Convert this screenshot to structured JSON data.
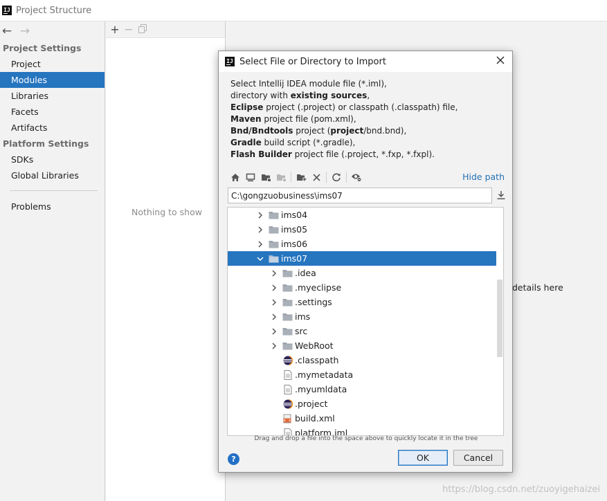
{
  "window": {
    "title": "Project Structure"
  },
  "sidebar": {
    "nav_back": "←",
    "nav_forward": "→",
    "sections": [
      {
        "title": "Project Settings",
        "items": [
          "Project",
          "Modules",
          "Libraries",
          "Facets",
          "Artifacts"
        ]
      },
      {
        "title": "Platform Settings",
        "items": [
          "SDKs",
          "Global Libraries"
        ]
      }
    ],
    "selected_item": "Modules",
    "problems": "Problems"
  },
  "middle": {
    "toolbar": {
      "add": "+",
      "remove": "−",
      "copy": "copy-icon"
    },
    "empty_text": "Nothing to show"
  },
  "right": {
    "partial_text": "details here"
  },
  "dialog": {
    "title": "Select File or Directory to Import",
    "description": [
      [
        {
          "t": "Select Intellij IDEA module file (*.iml),",
          "b": false
        }
      ],
      [
        {
          "t": "directory with ",
          "b": false
        },
        {
          "t": "existing sources",
          "b": true
        },
        {
          "t": ",",
          "b": false
        }
      ],
      [
        {
          "t": "Eclipse",
          "b": true
        },
        {
          "t": " project (.project) or classpath (.classpath) file,",
          "b": false
        }
      ],
      [
        {
          "t": "Maven",
          "b": true
        },
        {
          "t": " project file (pom.xml),",
          "b": false
        }
      ],
      [
        {
          "t": "Bnd/Bndtools",
          "b": true
        },
        {
          "t": " project (",
          "b": false
        },
        {
          "t": "project",
          "b": true
        },
        {
          "t": "/bnd.bnd),",
          "b": false
        }
      ],
      [
        {
          "t": "Gradle",
          "b": true
        },
        {
          "t": " build script (*.gradle),",
          "b": false
        }
      ],
      [
        {
          "t": "Flash Builder",
          "b": true
        },
        {
          "t": " project file (.project, *.fxp, *.fxpl).",
          "b": false
        }
      ]
    ],
    "toolbar_icons": [
      "home-icon",
      "desktop-icon",
      "project-folder-icon",
      "module-folder-icon",
      "new-folder-icon",
      "delete-icon",
      "refresh-icon",
      "show-hidden-icon"
    ],
    "hide_path": "Hide path",
    "path_value": "C:\\gongzuobusiness\\ims07",
    "tree": [
      {
        "label": "ims04",
        "indent": 0,
        "expandable": true,
        "expanded": false,
        "icon": "folder"
      },
      {
        "label": "ims05",
        "indent": 0,
        "expandable": true,
        "expanded": false,
        "icon": "folder"
      },
      {
        "label": "ims06",
        "indent": 0,
        "expandable": true,
        "expanded": false,
        "icon": "folder"
      },
      {
        "label": "ims07",
        "indent": 0,
        "expandable": true,
        "expanded": true,
        "icon": "folder",
        "selected": true
      },
      {
        "label": ".idea",
        "indent": 1,
        "expandable": true,
        "expanded": false,
        "icon": "folder"
      },
      {
        "label": ".myeclipse",
        "indent": 1,
        "expandable": true,
        "expanded": false,
        "icon": "folder"
      },
      {
        "label": ".settings",
        "indent": 1,
        "expandable": true,
        "expanded": false,
        "icon": "folder"
      },
      {
        "label": "ims",
        "indent": 1,
        "expandable": true,
        "expanded": false,
        "icon": "folder"
      },
      {
        "label": "src",
        "indent": 1,
        "expandable": true,
        "expanded": false,
        "icon": "folder"
      },
      {
        "label": "WebRoot",
        "indent": 1,
        "expandable": true,
        "expanded": false,
        "icon": "folder"
      },
      {
        "label": ".classpath",
        "indent": 1,
        "expandable": false,
        "icon": "eclipse"
      },
      {
        "label": ".mymetadata",
        "indent": 1,
        "expandable": false,
        "icon": "file"
      },
      {
        "label": ".myumldata",
        "indent": 1,
        "expandable": false,
        "icon": "file"
      },
      {
        "label": ".project",
        "indent": 1,
        "expandable": false,
        "icon": "eclipse"
      },
      {
        "label": "build.xml",
        "indent": 1,
        "expandable": false,
        "icon": "xml"
      },
      {
        "label": "platform.iml",
        "indent": 1,
        "expandable": false,
        "icon": "file"
      }
    ],
    "hint": "Drag and drop a file into the space above to quickly locate it in the tree",
    "help": "?",
    "ok": "OK",
    "cancel": "Cancel"
  },
  "watermark": "https://blog.csdn.net/zuoyigehaizei",
  "colors": {
    "selection": "#2675bf",
    "link": "#2470b3",
    "help": "#2470c6"
  }
}
